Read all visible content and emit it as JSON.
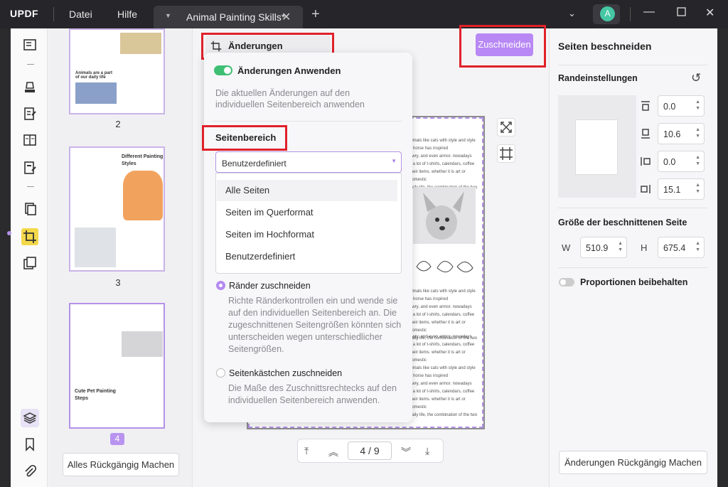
{
  "app": {
    "logo": "UPDF",
    "menu": [
      "Datei",
      "Hilfe"
    ]
  },
  "tab": {
    "title": "Animal Painting Skills*"
  },
  "user": {
    "avatar_letter": "A"
  },
  "thumbnails": {
    "pages": [
      {
        "number": "2",
        "heading": "Animals are a part of our daily life"
      },
      {
        "number": "3",
        "heading": "Different Painting Styles"
      },
      {
        "number": "4",
        "heading": "Cute Pet Painting Steps"
      }
    ],
    "undo_all": "Alles Rückgängig Machen"
  },
  "toolbar": {
    "apply_changes": "Änderungen Anwenden",
    "crop_button": "Zuschneiden"
  },
  "popup": {
    "toggle_label": "Änderungen Anwenden",
    "toggle_desc": "Die aktuellen Änderungen auf den individuellen Seitenbereich anwenden",
    "range_title": "Seitenbereich",
    "select_value": "Benutzerdefiniert",
    "options": [
      "Alle Seiten",
      "Seiten im Querformat",
      "Seiten im Hochformat",
      "Benutzerdefiniert"
    ],
    "radio1_label": "Ränder zuschneiden",
    "radio1_desc": "Richte Ränderkontrollen ein und wende sie auf den individuellen Seitenbereich an. Die zugeschnittenen Seitengrößen könnten sich unterscheiden wegen unterschiedlicher Seitengrößen.",
    "radio2_label": "Seitenkästchen zuschneiden",
    "radio2_desc": "Die Maße des Zuschnittsrechtecks auf den individuellen Seitenbereich anwenden."
  },
  "document_text": [
    "nimals like cats with style and style",
    "e horse has inspired",
    "ewry, and even armor. nowadays",
    "s a lot of t-shirts, calendars, coffee",
    "their items. whether it is art or domestic",
    "daily life, the combination of the two"
  ],
  "navigation": {
    "page_current": "4",
    "page_total": "9"
  },
  "right": {
    "title": "Seiten beschneiden",
    "margins_title": "Randeinstellungen",
    "margins": {
      "top": "0.0",
      "bottom": "10.6",
      "left": "0.0",
      "right": "15.1"
    },
    "size_title": "Größe der beschnittenen Seite",
    "w_label": "W",
    "w_value": "510.9",
    "h_label": "H",
    "h_value": "675.4",
    "keep_ratio": "Proportionen beibehalten",
    "undo": "Änderungen Rückgängig Machen"
  },
  "colors": {
    "accent": "#b888f4",
    "highlight": "#e0212a",
    "toggle_on": "#3fbf73"
  }
}
